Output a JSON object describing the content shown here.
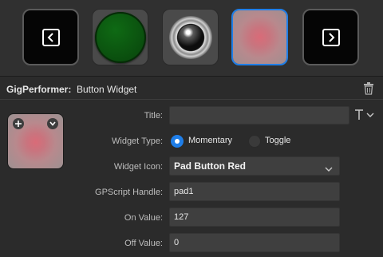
{
  "palette": {
    "accent": "#1f7ee8",
    "background": "#2b2b2b",
    "field": "#3f3f3f",
    "green_led": "#0a4d0e",
    "pad_red": "#d96b78"
  },
  "widget_strip": [
    {
      "kind": "nav-left",
      "icon": "chevron-left-icon"
    },
    {
      "kind": "led-green",
      "icon": "green-led"
    },
    {
      "kind": "knob",
      "icon": "knob"
    },
    {
      "kind": "pad-red",
      "icon": "pad-red",
      "selected": true
    },
    {
      "kind": "nav-right",
      "icon": "chevron-right-icon"
    }
  ],
  "header": {
    "app_name": "GigPerformer:",
    "widget_kind": "Button Widget",
    "delete_icon": "trash-icon"
  },
  "preview": {
    "add_icon": "plus-icon",
    "menu_icon": "chevron-down-icon"
  },
  "form": {
    "title": {
      "label": "Title:",
      "value": "",
      "font_icon": "text-format-icon"
    },
    "widget_type": {
      "label": "Widget Type:",
      "options": [
        {
          "label": "Momentary",
          "selected": true
        },
        {
          "label": "Toggle",
          "selected": false
        }
      ]
    },
    "widget_icon": {
      "label": "Widget Icon:",
      "value": "Pad Button Red"
    },
    "gpscript_handle": {
      "label": "GPScript Handle:",
      "value": "pad1"
    },
    "on_value": {
      "label": "On Value:",
      "value": "127"
    },
    "off_value": {
      "label": "Off Value:",
      "value": "0"
    }
  }
}
